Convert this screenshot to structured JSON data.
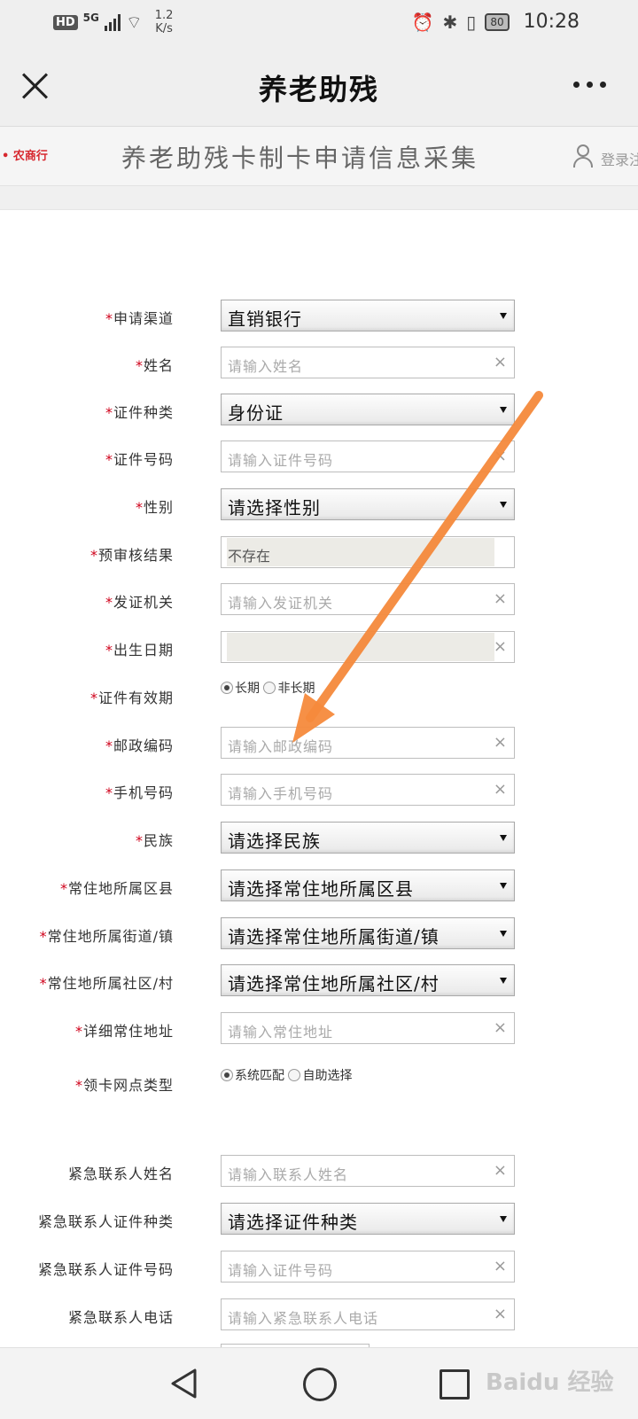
{
  "status": {
    "hd": "HD",
    "network": "5G",
    "speed_value": "1.2",
    "speed_unit": "K/s",
    "battery": "80",
    "time": "10:28"
  },
  "titlebar": {
    "title": "养老助残"
  },
  "banner": {
    "bank_logo": "• 农商行",
    "title": "养老助残卡制卡申请信息采集",
    "login": "登录注"
  },
  "form": {
    "channel": {
      "label": "申请渠道",
      "value": "直销银行"
    },
    "name": {
      "label": "姓名",
      "placeholder": "请输入姓名"
    },
    "id_type": {
      "label": "证件种类",
      "value": "身份证"
    },
    "id_number": {
      "label": "证件号码",
      "placeholder": "请输入证件号码"
    },
    "gender": {
      "label": "性别",
      "value": "请选择性别"
    },
    "precheck": {
      "label": "预审核结果",
      "value": "不存在"
    },
    "issuer": {
      "label": "发证机关",
      "placeholder": "请输入发证机关"
    },
    "birth": {
      "label": "出生日期"
    },
    "validity": {
      "label": "证件有效期",
      "opt1": "长期",
      "opt2": "非长期"
    },
    "postal": {
      "label": "邮政编码",
      "placeholder": "请输入邮政编码"
    },
    "phone": {
      "label": "手机号码",
      "placeholder": "请输入手机号码"
    },
    "ethnicity": {
      "label": "民族",
      "value": "请选择民族"
    },
    "district": {
      "label": "常住地所属区县",
      "value": "请选择常住地所属区县"
    },
    "street": {
      "label": "常住地所属街道/镇",
      "value": "请选择常住地所属街道/镇"
    },
    "community": {
      "label": "常住地所属社区/村",
      "value": "请选择常住地所属社区/村"
    },
    "address": {
      "label": "详细常住地址",
      "placeholder": "请输入常住地址"
    },
    "branch_type": {
      "label": "领卡网点类型",
      "opt1": "系统匹配",
      "opt2": "自助选择"
    },
    "ec_name": {
      "label": "紧急联系人姓名",
      "placeholder": "请输入联系人姓名"
    },
    "ec_id_type": {
      "label": "紧急联系人证件种类",
      "value": "请选择证件种类"
    },
    "ec_id_number": {
      "label": "紧急联系人证件号码",
      "placeholder": "请输入证件号码"
    },
    "ec_phone": {
      "label": "紧急联系人电话",
      "placeholder": "请输入紧急联系人电话"
    }
  },
  "watermark": "Baidu 经验",
  "colors": {
    "required": "#d0021b",
    "arrow": "#f58a3c",
    "brand": "#d7282f"
  }
}
